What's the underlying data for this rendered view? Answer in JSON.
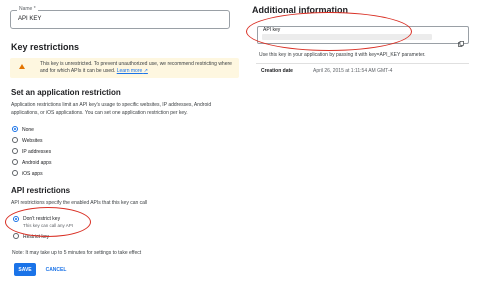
{
  "name_field": {
    "label": "Name *",
    "value": "API KEY"
  },
  "key_restrictions": {
    "title": "Key restrictions",
    "warning_text": "This key is unrestricted. To prevent unauthorized use, we recommend restricting where and for which APIs it can be used.",
    "learn_more": "Learn more"
  },
  "app_restriction": {
    "title": "Set an application restriction",
    "description": "Application restrictions limit an API key's usage to specific websites, IP addresses, Android applications, or iOS applications. You can set one application restriction per key.",
    "options": [
      "None",
      "Websites",
      "IP addresses",
      "Android apps",
      "iOS apps"
    ],
    "selected": "None"
  },
  "api_restrictions": {
    "title": "API restrictions",
    "description": "API restrictions specify the enabled APIs that this key can call",
    "options": [
      {
        "label": "Don't restrict key",
        "sub": "This key can call any API"
      },
      {
        "label": "Restrict key",
        "sub": ""
      }
    ],
    "selected": "Don't restrict key"
  },
  "note": "Note: It may take up to 5 minutes for settings to take effect",
  "buttons": {
    "save": "SAVE",
    "cancel": "CANCEL"
  },
  "additional_info": {
    "title": "Additional information",
    "api_key_label": "API key",
    "hint": "Use this key in your application by passing it with key=API_KEY parameter.",
    "creation_date_label": "Creation date",
    "creation_date_value": "April 26, 2015 at 1:11:54 AM GMT-4"
  },
  "colors": {
    "accent": "#1a73e8",
    "warning_bg": "#fef7e0",
    "warning_icon": "#e37400",
    "annotation": "#d93025"
  },
  "icons": {
    "warning": "warning-icon",
    "copy": "copy-icon",
    "learn_more": "external-link-icon"
  }
}
